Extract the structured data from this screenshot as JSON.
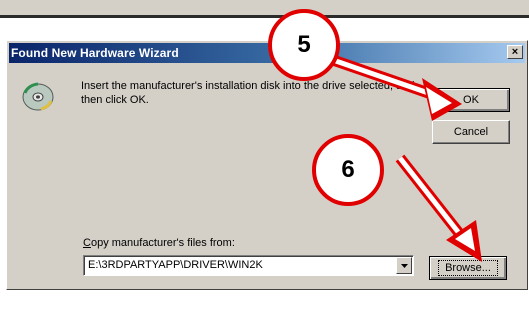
{
  "dialog": {
    "title": "Found New Hardware Wizard",
    "close_label": "×",
    "message": "Insert the manufacturer's installation disk into the drive selected, and then click OK.",
    "copy_label": "Copy manufacturer's files from:",
    "path_value": "E:\\3RDPARTYAPP\\DRIVER\\WIN2K",
    "ok_label": "OK",
    "cancel_label": "Cancel",
    "browse_label": "Browse..."
  },
  "annotations": {
    "step_5": "5",
    "step_6": "6",
    "arrow_color": "#e00000"
  },
  "icons": {
    "cd": "cd-disk-icon",
    "dropdown": "chevron-down-icon"
  }
}
